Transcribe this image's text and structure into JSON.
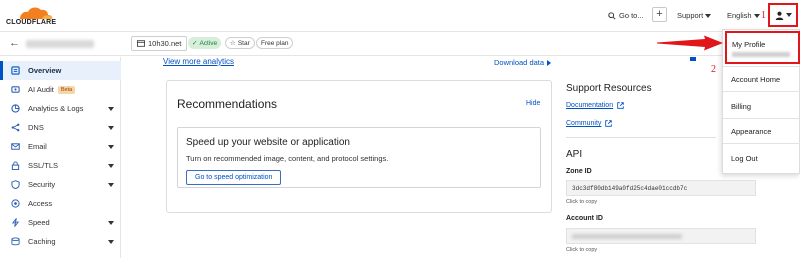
{
  "topbar": {
    "brand": "CLOUDFLARE",
    "goto_label": "Go to...",
    "support_label": "Support",
    "language_label": "English",
    "annotation_1": "1"
  },
  "zone": {
    "domain": "10h30.net",
    "status": "Active",
    "star_label": "Star",
    "plan": "Free plan"
  },
  "sidebar": {
    "items": [
      {
        "label": "Overview",
        "icon": "overview-icon",
        "active": true,
        "caret": false
      },
      {
        "label": "AI Audit",
        "icon": "ai-audit-icon",
        "badge": "Beta",
        "caret": false
      },
      {
        "label": "Analytics & Logs",
        "icon": "analytics-icon",
        "caret": true
      },
      {
        "label": "DNS",
        "icon": "dns-icon",
        "caret": true
      },
      {
        "label": "Email",
        "icon": "email-icon",
        "caret": true
      },
      {
        "label": "SSL/TLS",
        "icon": "lock-icon",
        "caret": true
      },
      {
        "label": "Security",
        "icon": "shield-icon",
        "caret": true
      },
      {
        "label": "Access",
        "icon": "access-icon",
        "caret": false
      },
      {
        "label": "Speed",
        "icon": "speed-icon",
        "caret": true
      },
      {
        "label": "Caching",
        "icon": "caching-icon",
        "caret": true
      }
    ]
  },
  "main": {
    "more_analytics": "View more analytics",
    "download_data": "Download data",
    "recommendations": {
      "title": "Recommendations",
      "hide": "Hide",
      "card_title": "Speed up your website or application",
      "card_desc": "Turn on recommended image, content, and protocol settings.",
      "button": "Go to speed optimization"
    }
  },
  "right": {
    "support_title": "Support Resources",
    "documentation": "Documentation",
    "community": "Community",
    "api_title": "API",
    "zone_id_label": "Zone ID",
    "zone_id": "3dc3df80db149a0fd25c4dae01ccdb7c",
    "click_to_copy": "Click to copy",
    "account_id_label": "Account ID",
    "click_to_copy_2": "Click to copy"
  },
  "dropdown": {
    "items": [
      "My Profile",
      "Account Home",
      "Billing",
      "Appearance",
      "Log Out"
    ],
    "annotation_2": "2"
  },
  "colors": {
    "accent": "#0051c3",
    "highlight": "#e0161b",
    "active_green": "#1e7a35",
    "brand_orange": "#f38020"
  }
}
